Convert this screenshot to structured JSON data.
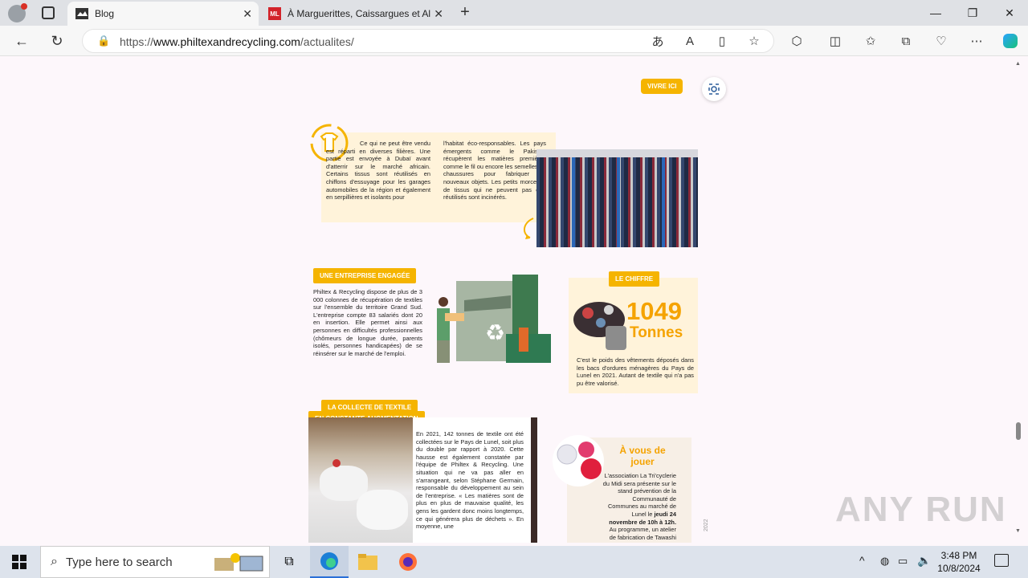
{
  "browser": {
    "tabs": [
      {
        "title": "Blog",
        "active": true
      },
      {
        "title": "À Marguerittes, Caissargues et Al",
        "active": false
      }
    ],
    "url_prefix": "https://",
    "url_domain": "www.philtexandrecycling.com",
    "url_path": "/actualites/"
  },
  "page": {
    "section_badge": "VIVRE ICI",
    "intro_col1": "Ce qui ne peut être vendu est réparti en diverses filières. Une partie est envoyée à Dubaï avant d'atterrir sur le marché africain. Certains tissus sont réutilisés en chiffons d'essuyage pour les garages automobiles de la région et également en serpillières et isolants pour",
    "intro_col2": "l'habitat éco-responsables. Les pays émergents comme le Pakistan récupèrent les matières premières comme le fil ou encore les semelles de chaussures pour fabriquer de nouveaux objets. Les petits morceaux de tissus qui ne peuvent pas être réutilisés sont incinérés.",
    "entreprise_badge": "UNE ENTREPRISE ENGAGÉE",
    "entreprise_text": "Philtex & Recycling dispose de plus de 3 000 colonnes de récupération de textiles sur l'ensemble du territoire Grand Sud. L'entreprise compte 83 salariés dont 20 en insertion. Elle permet ainsi aux personnes en difficultés professionnelles (chômeurs de longue durée, parents isolés, personnes handicapées) de se réinsérer sur le marché de l'emploi.",
    "chiffre_badge": "LE CHIFFRE",
    "chiffre_number": "1049",
    "chiffre_unit": "Tonnes",
    "chiffre_text": "C'est le poids des vêtements déposés dans les bacs d'ordures ménagères du Pays de Lunel en 2021. Autant de textile qui n'a pas pu être valorisé.",
    "collecte_badge_1": "LA COLLECTE DE TEXTILE",
    "collecte_badge_2": "EN CONSTANTE AUGMENTATION",
    "collecte_text": "En 2021, 142 tonnes de textile ont été collectées sur le Pays de Lunel, soit plus du double par rapport à 2020. Cette hausse est également constatée par l'équipe de Philtex & Recycling. Une situation qui ne va pas aller en s'arrangeant, selon Stéphane Germain, responsable du développement au sein de l'entreprise. « Les matières sont de plus en plus de mauvaise qualité, les gens les gardent donc moins longtemps, ce qui générera plus de déchets ». En moyenne, une",
    "jouer_title": "À vous de jouer",
    "jouer_text_a": "L'association La Tri'cyclerie du Midi sera présente sur le stand prévention de la Communauté de Communes au marché de Lunel le ",
    "jouer_text_bold": "jeudi 24 novembre de 10h à 12h.",
    "jouer_text_b": " Au programme, un atelier de fabrication de Tawashi",
    "side_year": "2022"
  },
  "taskbar": {
    "search_placeholder": "Type here to search",
    "time": "3:48 PM",
    "date": "10/8/2024"
  },
  "watermark": "ANY RUN"
}
